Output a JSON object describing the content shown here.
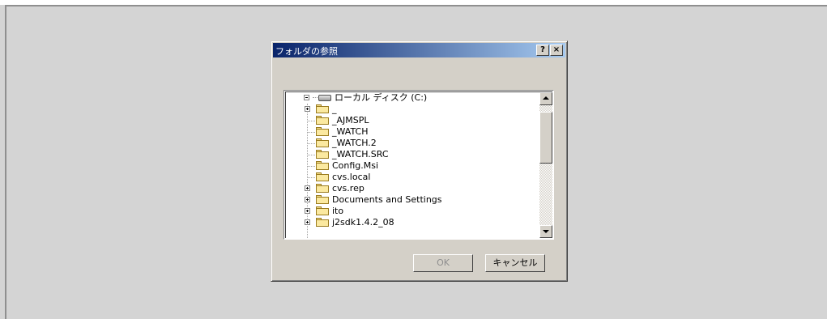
{
  "dialog": {
    "title": "フォルダの参照",
    "help_button": "?",
    "close_button": "×"
  },
  "tree": {
    "root": {
      "label": "ローカル ディスク (C:)",
      "expanded": true,
      "icon": "drive-icon"
    },
    "items": [
      {
        "label": "_",
        "expandable": true
      },
      {
        "label": "_AJMSPL",
        "expandable": false
      },
      {
        "label": "_WATCH",
        "expandable": false
      },
      {
        "label": "_WATCH.2",
        "expandable": false
      },
      {
        "label": "_WATCH.SRC",
        "expandable": false
      },
      {
        "label": "Config.Msi",
        "expandable": false
      },
      {
        "label": "cvs.local",
        "expandable": false
      },
      {
        "label": "cvs.rep",
        "expandable": true
      },
      {
        "label": "Documents and Settings",
        "expandable": true
      },
      {
        "label": "ito",
        "expandable": true
      },
      {
        "label": "j2sdk1.4.2_08",
        "expandable": true
      }
    ]
  },
  "buttons": {
    "ok_label": "OK",
    "cancel_label": "キャンセル",
    "ok_enabled": false
  },
  "colors": {
    "titlebar_start": "#0a246a",
    "titlebar_end": "#a6caf0",
    "dialog_bg": "#d4d0c8",
    "folder_yellow": "#fbe9a0"
  }
}
